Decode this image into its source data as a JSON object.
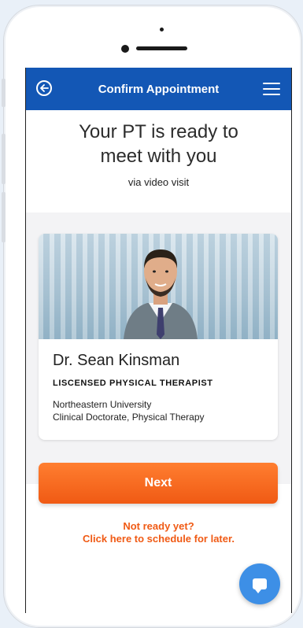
{
  "header": {
    "title": "Confirm Appointment",
    "back_icon": "back-arrow-icon",
    "menu_icon": "hamburger-menu-icon",
    "color": "#1357b5"
  },
  "intro": {
    "headline_line1": "Your PT is ready to",
    "headline_line2": "meet with you",
    "subline": "via video visit"
  },
  "therapist": {
    "name": "Dr. Sean Kinsman",
    "title": "LISCENSED PHYSICAL THERAPIST",
    "school": "Northeastern University",
    "degree": "Clinical Doctorate, Physical Therapy"
  },
  "actions": {
    "next_label": "Next",
    "later_line1": "Not ready yet?",
    "later_line2": "Click here to schedule for later.",
    "accent_color": "#f05a14"
  },
  "chat": {
    "icon": "chat-bubble-icon",
    "color": "#3d8fe6"
  }
}
